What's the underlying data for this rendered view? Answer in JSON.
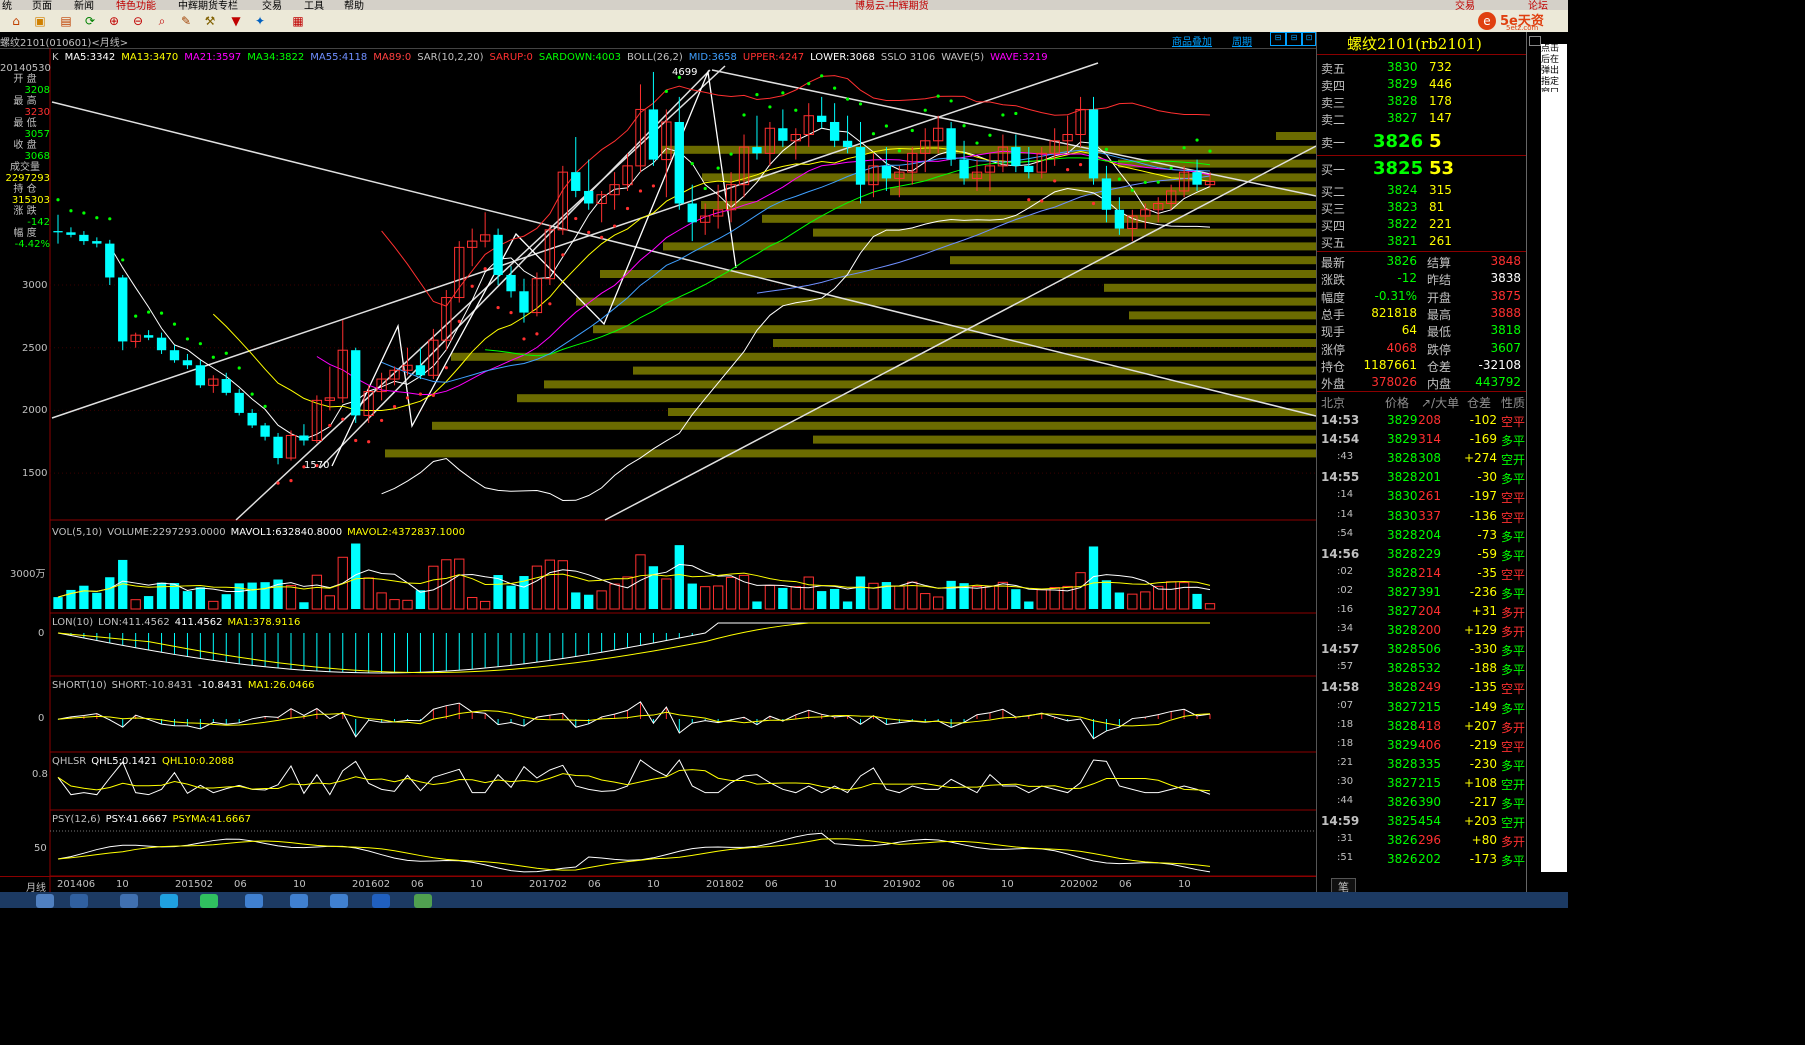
{
  "menu": {
    "items": [
      "统",
      "页面",
      "新闻",
      "特色功能",
      "中辉期货专栏",
      "交易",
      "工具",
      "帮助"
    ],
    "window_title": "博易云-中辉期货",
    "trade": "交易",
    "forum": "论坛",
    "brand": "5e天资",
    "brand_sub": "5etz.com"
  },
  "header": {
    "symbol_line": "螺纹2101(010601)<月线>",
    "overlay_btn": "商品叠加",
    "period_btn": "周期"
  },
  "indicators_line": [
    {
      "text": "K",
      "color": "#c0c0c0"
    },
    {
      "text": "MA5:3342",
      "color": "#ffffff"
    },
    {
      "text": "MA13:3470",
      "color": "#ffff00"
    },
    {
      "text": "MA21:3597",
      "color": "#ff00ff"
    },
    {
      "text": "MA34:3822",
      "color": "#00ff00"
    },
    {
      "text": "MA55:4118",
      "color": "#6f8fff"
    },
    {
      "text": "MA89:0",
      "color": "#ff4040"
    },
    {
      "text": "SAR(10,2,20)",
      "color": "#c0c0c0"
    },
    {
      "text": "SARUP:0",
      "color": "#ff3030"
    },
    {
      "text": "SARDOWN:4003",
      "color": "#00ff00"
    },
    {
      "text": "BOLL(26,2)",
      "color": "#c0c0c0"
    },
    {
      "text": "MID:3658",
      "color": "#3fa0ff"
    },
    {
      "text": "UPPER:4247",
      "color": "#ff3030"
    },
    {
      "text": "LOWER:3068",
      "color": "#ffffff"
    },
    {
      "text": "SSLO 3106",
      "color": "#c0c0c0"
    },
    {
      "text": "WAVE(5)",
      "color": "#c0c0c0"
    },
    {
      "text": "WAVE:3219",
      "color": "#ff00ff"
    }
  ],
  "side_info": [
    {
      "label": "20140530",
      "value": ""
    },
    {
      "label": "开 盘",
      "value": "3208"
    },
    {
      "label": "最 高",
      "value": "3230"
    },
    {
      "label": "最 低",
      "value": "3057"
    },
    {
      "label": "收 盘",
      "value": "3068"
    },
    {
      "label": "成交量",
      "value": "2297293"
    },
    {
      "label": "持 仓",
      "value": "315303"
    },
    {
      "label": "涨 跌",
      "value": "-142"
    },
    {
      "label": "幅 度",
      "value": "-4.42%"
    }
  ],
  "price_axis": [
    "3000",
    "2500",
    "2000",
    "1500"
  ],
  "price_marks": {
    "high": "4699",
    "low": "1570"
  },
  "sub_panels": {
    "vol": {
      "title": "VOL(5,10)",
      "parts": [
        {
          "text": "VOLUME:2297293.0000",
          "color": "#c0c0c0"
        },
        {
          "text": "MAVOL1:632840.8000",
          "color": "#ffffff"
        },
        {
          "text": "MAVOL2:4372837.1000",
          "color": "#ffff00"
        }
      ],
      "axis": "3000万"
    },
    "lon": {
      "title": "LON(10)",
      "parts": [
        {
          "text": "LON:411.4562",
          "color": "#c0c0c0"
        },
        {
          "text": "411.4562",
          "color": "#ffffff"
        },
        {
          "text": "MA1:378.9116",
          "color": "#ffff00"
        }
      ],
      "axis": "0"
    },
    "short": {
      "title": "SHORT(10)",
      "parts": [
        {
          "text": "SHORT:-10.8431",
          "color": "#c0c0c0"
        },
        {
          "text": "-10.8431",
          "color": "#ffffff"
        },
        {
          "text": "MA1:26.0466",
          "color": "#ffff00"
        }
      ],
      "axis": "0"
    },
    "qhlsr": {
      "title": "QHLSR",
      "parts": [
        {
          "text": "QHL5:0.1421",
          "color": "#ffffff"
        },
        {
          "text": "QHL10:0.2088",
          "color": "#ffff00"
        }
      ],
      "axis": "0.8"
    },
    "psy": {
      "title": "PSY(12,6)",
      "parts": [
        {
          "text": "PSY:41.6667",
          "color": "#ffffff"
        },
        {
          "text": "PSYMA:41.6667",
          "color": "#ffff00"
        }
      ],
      "axis": "50"
    }
  },
  "x_axis": {
    "period": "月线",
    "labels": [
      "201406",
      "10",
      "201502",
      "06",
      "10",
      "201602",
      "06",
      "10",
      "201702",
      "06",
      "10",
      "201802",
      "06",
      "10",
      "201902",
      "06",
      "10",
      "202002",
      "06",
      "10"
    ]
  },
  "quote": {
    "title": "螺纹2101(rb2101)",
    "asks": [
      {
        "label": "卖五",
        "price": "3830",
        "vol": "732"
      },
      {
        "label": "卖四",
        "price": "3829",
        "vol": "446"
      },
      {
        "label": "卖三",
        "price": "3828",
        "vol": "178"
      },
      {
        "label": "卖二",
        "price": "3827",
        "vol": "147"
      },
      {
        "label": "卖一",
        "price": "3826",
        "vol": "5"
      }
    ],
    "bids": [
      {
        "label": "买一",
        "price": "3825",
        "vol": "53"
      },
      {
        "label": "买二",
        "price": "3824",
        "vol": "315"
      },
      {
        "label": "买三",
        "price": "3823",
        "vol": "81"
      },
      {
        "label": "买四",
        "price": "3822",
        "vol": "221"
      },
      {
        "label": "买五",
        "price": "3821",
        "vol": "261"
      }
    ],
    "stats": [
      {
        "l1": "最新",
        "v1": "3826",
        "c1": "#00ff00",
        "l2": "结算",
        "v2": "3848",
        "c2": "#ff3030"
      },
      {
        "l1": "涨跌",
        "v1": "-12",
        "c1": "#00ff00",
        "l2": "昨结",
        "v2": "3838",
        "c2": "#ffffff"
      },
      {
        "l1": "幅度",
        "v1": "-0.31%",
        "c1": "#00ff00",
        "l2": "开盘",
        "v2": "3875",
        "c2": "#ff3030"
      },
      {
        "l1": "总手",
        "v1": "821818",
        "c1": "#ffff00",
        "l2": "最高",
        "v2": "3888",
        "c2": "#ff3030"
      },
      {
        "l1": "现手",
        "v1": "64",
        "c1": "#ffff00",
        "l2": "最低",
        "v2": "3818",
        "c2": "#00ff00"
      },
      {
        "l1": "涨停",
        "v1": "4068",
        "c1": "#ff3030",
        "l2": "跌停",
        "v2": "3607",
        "c2": "#00ff00"
      },
      {
        "l1": "持仓",
        "v1": "1187661",
        "c1": "#ffff00",
        "l2": "仓差",
        "v2": "-32108",
        "c2": "#ffffff"
      },
      {
        "l1": "外盘",
        "v1": "378026",
        "c1": "#ff3030",
        "l2": "内盘",
        "v2": "443792",
        "c2": "#00ff00"
      }
    ],
    "tick_header": {
      "c0": "北京",
      "c1": "价格",
      "c2": "↗/大单",
      "c3": "仓差",
      "c4": "性质"
    },
    "ticks": [
      {
        "t": "14:53",
        "p": "3829",
        "v": "208",
        "d": "-102",
        "n": "空平",
        "bold": true,
        "vc": "#ff3030",
        "nc": "#ff3030"
      },
      {
        "t": "14:54",
        "p": "3829",
        "v": "314",
        "d": "-169",
        "n": "多平",
        "bold": true,
        "vc": "#ff3030",
        "nc": "#00ff00"
      },
      {
        "t": ":43",
        "p": "3828",
        "v": "308",
        "d": "+274",
        "n": "空开",
        "bold": false,
        "vc": "#00ff00",
        "nc": "#00ff00"
      },
      {
        "t": "14:55",
        "p": "3828",
        "v": "201",
        "d": "-30",
        "n": "多平",
        "bold": true,
        "vc": "#00ff00",
        "nc": "#00ff00"
      },
      {
        "t": ":14",
        "p": "3830",
        "v": "261",
        "d": "-197",
        "n": "空平",
        "bold": false,
        "vc": "#ff3030",
        "nc": "#ff3030"
      },
      {
        "t": ":14",
        "p": "3830",
        "v": "337",
        "d": "-136",
        "n": "空平",
        "bold": false,
        "vc": "#ff3030",
        "nc": "#ff3030"
      },
      {
        "t": ":54",
        "p": "3828",
        "v": "204",
        "d": "-73",
        "n": "多平",
        "bold": false,
        "vc": "#00ff00",
        "nc": "#00ff00"
      },
      {
        "t": "14:56",
        "p": "3828",
        "v": "229",
        "d": "-59",
        "n": "多平",
        "bold": true,
        "vc": "#00ff00",
        "nc": "#00ff00"
      },
      {
        "t": ":02",
        "p": "3828",
        "v": "214",
        "d": "-35",
        "n": "空平",
        "bold": false,
        "vc": "#ff3030",
        "nc": "#ff3030"
      },
      {
        "t": ":02",
        "p": "3827",
        "v": "391",
        "d": "-236",
        "n": "多平",
        "bold": false,
        "vc": "#00ff00",
        "nc": "#00ff00"
      },
      {
        "t": ":16",
        "p": "3827",
        "v": "204",
        "d": "+31",
        "n": "多开",
        "bold": false,
        "vc": "#ff3030",
        "nc": "#ff3030"
      },
      {
        "t": ":34",
        "p": "3828",
        "v": "200",
        "d": "+129",
        "n": "多开",
        "bold": false,
        "vc": "#ff3030",
        "nc": "#ff3030"
      },
      {
        "t": "14:57",
        "p": "3828",
        "v": "506",
        "d": "-330",
        "n": "多平",
        "bold": true,
        "vc": "#00ff00",
        "nc": "#00ff00"
      },
      {
        "t": ":57",
        "p": "3828",
        "v": "532",
        "d": "-188",
        "n": "多平",
        "bold": false,
        "vc": "#00ff00",
        "nc": "#00ff00"
      },
      {
        "t": "14:58",
        "p": "3828",
        "v": "249",
        "d": "-135",
        "n": "空平",
        "bold": true,
        "vc": "#ff3030",
        "nc": "#ff3030"
      },
      {
        "t": ":07",
        "p": "3827",
        "v": "215",
        "d": "-149",
        "n": "多平",
        "bold": false,
        "vc": "#00ff00",
        "nc": "#00ff00"
      },
      {
        "t": ":18",
        "p": "3828",
        "v": "418",
        "d": "+207",
        "n": "多开",
        "bold": false,
        "vc": "#ff3030",
        "nc": "#ff3030"
      },
      {
        "t": ":18",
        "p": "3829",
        "v": "406",
        "d": "-219",
        "n": "空平",
        "bold": false,
        "vc": "#ff3030",
        "nc": "#ff3030"
      },
      {
        "t": ":21",
        "p": "3828",
        "v": "335",
        "d": "-230",
        "n": "多平",
        "bold": false,
        "vc": "#00ff00",
        "nc": "#00ff00"
      },
      {
        "t": ":30",
        "p": "3827",
        "v": "215",
        "d": "+108",
        "n": "空开",
        "bold": false,
        "vc": "#00ff00",
        "nc": "#00ff00"
      },
      {
        "t": ":44",
        "p": "3826",
        "v": "390",
        "d": "-217",
        "n": "多平",
        "bold": false,
        "vc": "#00ff00",
        "nc": "#00ff00"
      },
      {
        "t": "14:59",
        "p": "3825",
        "v": "454",
        "d": "+203",
        "n": "空开",
        "bold": true,
        "vc": "#00ff00",
        "nc": "#00ff00"
      },
      {
        "t": ":31",
        "p": "3826",
        "v": "296",
        "d": "+80",
        "n": "多开",
        "bold": false,
        "vc": "#ff3030",
        "nc": "#ff3030"
      },
      {
        "t": ":51",
        "p": "3826",
        "v": "202",
        "d": "-173",
        "n": "多平",
        "bold": false,
        "vc": "#00ff00",
        "nc": "#00ff00"
      }
    ],
    "bottom_tab": "笔"
  },
  "right_note": "点击后在弹出指定窗口",
  "colors": {
    "up": "#ff3030",
    "down": "#00ffff",
    "volume_profile": "#6b6b00",
    "trendline": "#e0e0e0",
    "grid": "#8b0000"
  },
  "chart_data": {
    "type": "candlestick",
    "period": "monthly",
    "candles": [
      [
        3430,
        3560,
        3330,
        3420
      ],
      [
        3420,
        3460,
        3380,
        3400
      ],
      [
        3400,
        3430,
        3320,
        3350
      ],
      [
        3350,
        3380,
        3300,
        3330
      ],
      [
        3330,
        3360,
        3000,
        3060
      ],
      [
        3060,
        3080,
        2480,
        2550
      ],
      [
        2550,
        2620,
        2500,
        2600
      ],
      [
        2600,
        2640,
        2560,
        2580
      ],
      [
        2580,
        2620,
        2450,
        2480
      ],
      [
        2480,
        2520,
        2380,
        2400
      ],
      [
        2400,
        2450,
        2330,
        2360
      ],
      [
        2360,
        2400,
        2180,
        2200
      ],
      [
        2200,
        2280,
        2140,
        2250
      ],
      [
        2250,
        2300,
        2120,
        2140
      ],
      [
        2140,
        2170,
        1960,
        1980
      ],
      [
        1980,
        2010,
        1860,
        1880
      ],
      [
        1880,
        1900,
        1760,
        1790
      ],
      [
        1790,
        1820,
        1570,
        1620
      ],
      [
        1620,
        1840,
        1600,
        1800
      ],
      [
        1800,
        1890,
        1720,
        1760
      ],
      [
        1760,
        2120,
        1740,
        2080
      ],
      [
        2080,
        2350,
        2000,
        2100
      ],
      [
        2100,
        2720,
        2060,
        2480
      ],
      [
        2480,
        2500,
        1900,
        1960
      ],
      [
        1960,
        2200,
        1900,
        2150
      ],
      [
        2150,
        2300,
        2080,
        2250
      ],
      [
        2250,
        2350,
        2200,
        2320
      ],
      [
        2320,
        2500,
        2280,
        2360
      ],
      [
        2360,
        2500,
        2250,
        2280
      ],
      [
        2280,
        2650,
        2250,
        2560
      ],
      [
        2560,
        2960,
        2480,
        2900
      ],
      [
        2900,
        3350,
        2860,
        3300
      ],
      [
        3300,
        3450,
        3150,
        3350
      ],
      [
        3350,
        3580,
        3300,
        3400
      ],
      [
        3400,
        3450,
        3000,
        3080
      ],
      [
        3080,
        3150,
        2900,
        2950
      ],
      [
        2950,
        3050,
        2700,
        2780
      ],
      [
        2780,
        3100,
        2750,
        3050
      ],
      [
        3050,
        3480,
        3000,
        3440
      ],
      [
        3440,
        3950,
        3400,
        3900
      ],
      [
        3900,
        4180,
        3700,
        3750
      ],
      [
        3750,
        4000,
        3600,
        3650
      ],
      [
        3650,
        3750,
        3500,
        3720
      ],
      [
        3720,
        3900,
        3600,
        3800
      ],
      [
        3800,
        4050,
        3750,
        3950
      ],
      [
        3950,
        4600,
        3900,
        4400
      ],
      [
        4400,
        4699,
        3950,
        4000
      ],
      [
        4000,
        4400,
        3700,
        4300
      ],
      [
        4300,
        4500,
        3600,
        3650
      ],
      [
        3650,
        3800,
        3350,
        3500
      ],
      [
        3500,
        3650,
        3400,
        3550
      ],
      [
        3550,
        3800,
        3450,
        3600
      ],
      [
        3600,
        3900,
        3500,
        3800
      ],
      [
        3800,
        4200,
        3700,
        4100
      ],
      [
        4100,
        4350,
        4000,
        4050
      ],
      [
        4050,
        4300,
        3950,
        4250
      ],
      [
        4250,
        4400,
        4100,
        4150
      ],
      [
        4150,
        4250,
        4000,
        4200
      ],
      [
        4200,
        4450,
        4100,
        4350
      ],
      [
        4350,
        4500,
        4250,
        4300
      ],
      [
        4300,
        4450,
        4100,
        4150
      ],
      [
        4150,
        4350,
        4050,
        4100
      ],
      [
        4100,
        4300,
        3650,
        3800
      ],
      [
        3800,
        4050,
        3700,
        3950
      ],
      [
        3950,
        4100,
        3750,
        3850
      ],
      [
        3850,
        3950,
        3700,
        3900
      ],
      [
        3900,
        4100,
        3800,
        4050
      ],
      [
        4050,
        4250,
        3900,
        4150
      ],
      [
        4150,
        4350,
        4050,
        4250
      ],
      [
        4250,
        4300,
        3950,
        4000
      ],
      [
        4000,
        4150,
        3800,
        3850
      ],
      [
        3850,
        4000,
        3750,
        3900
      ],
      [
        3900,
        4050,
        3750,
        3950
      ],
      [
        3950,
        4200,
        3900,
        4100
      ],
      [
        4100,
        4200,
        3900,
        3950
      ],
      [
        3950,
        4100,
        3850,
        3900
      ],
      [
        3900,
        4100,
        3850,
        4050
      ],
      [
        4050,
        4250,
        3950,
        4150
      ],
      [
        4150,
        4350,
        4050,
        4200
      ],
      [
        4200,
        4500,
        4100,
        4400
      ],
      [
        4400,
        4500,
        3800,
        3850
      ],
      [
        3850,
        3950,
        3500,
        3600
      ],
      [
        3600,
        3700,
        3400,
        3450
      ],
      [
        3450,
        3600,
        3350,
        3550
      ],
      [
        3550,
        3650,
        3450,
        3600
      ],
      [
        3600,
        3700,
        3500,
        3650
      ],
      [
        3650,
        3800,
        3600,
        3750
      ],
      [
        3750,
        3950,
        3700,
        3900
      ],
      [
        3900,
        4000,
        3750,
        3800
      ],
      [
        3800,
        3900,
        3780,
        3826
      ]
    ]
  }
}
